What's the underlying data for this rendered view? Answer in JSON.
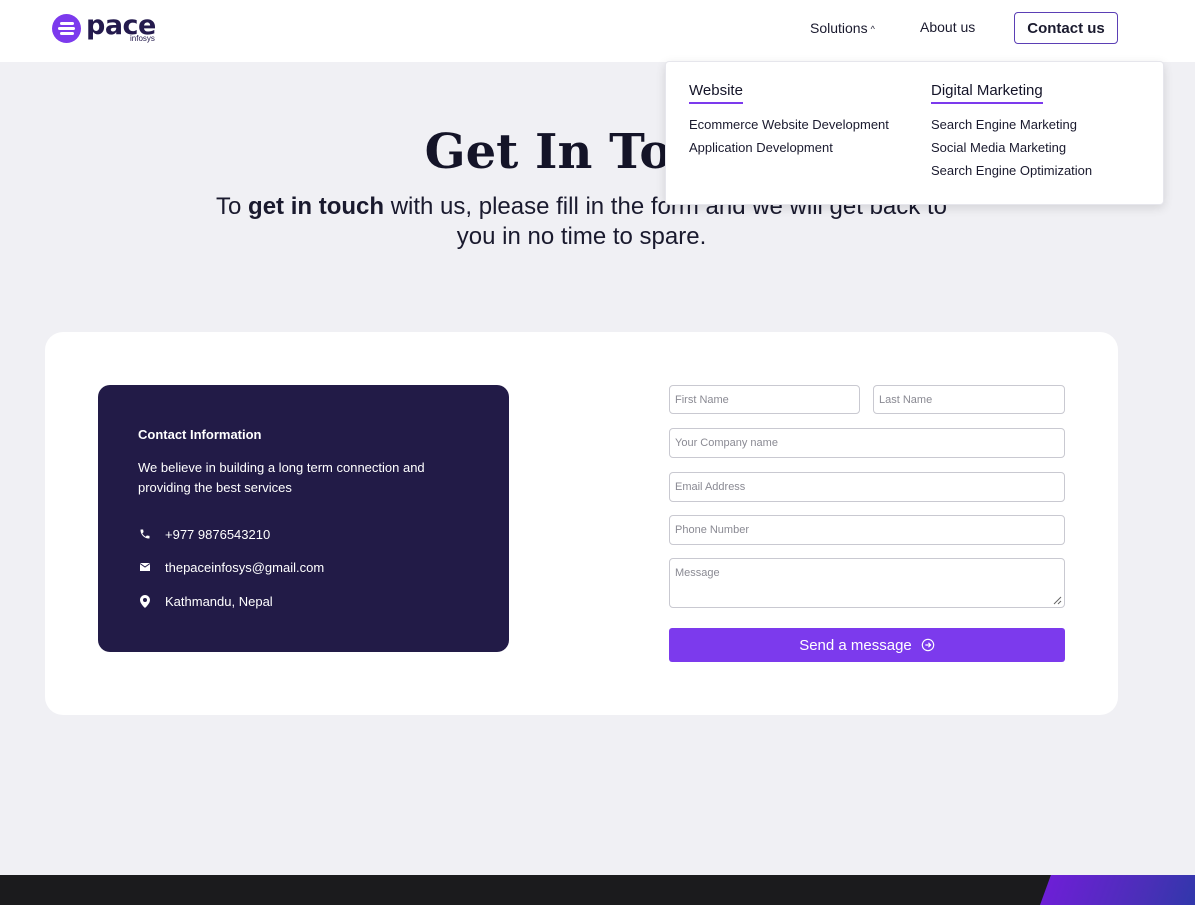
{
  "header": {
    "logo_text": "pace",
    "logo_sub": "infosys",
    "nav": {
      "solutions": "Solutions",
      "about": "About us",
      "contact": "Contact us"
    }
  },
  "dropdown": {
    "columns": [
      {
        "heading": "Website",
        "items": [
          "Ecommerce Website Development",
          "Application Development"
        ]
      },
      {
        "heading": "Digital Marketing",
        "items": [
          "Search Engine Marketing",
          "Social Media Marketing",
          "Search Engine Optimization"
        ]
      }
    ]
  },
  "hero": {
    "title": "Get In Touch",
    "sub_pre": "To ",
    "sub_bold": "get in touch",
    "sub_post": " with us, please fill in the form and we will get back to you in no time to spare."
  },
  "contact_info": {
    "title": "Contact Information",
    "description": "We believe in building a long term connection and providing the best services",
    "phone": "+977 9876543210",
    "email": "thepaceinfosys@gmail.com",
    "location": "Kathmandu, Nepal"
  },
  "form": {
    "first_name": "First Name",
    "last_name": "Last Name",
    "company": "Your Company name",
    "email": "Email Address",
    "phone": "Phone Number",
    "message": "Message",
    "submit": "Send a message"
  },
  "colors": {
    "accent": "#7c3aed",
    "card_dark": "#221b47",
    "footer": "#1b1b1d"
  }
}
